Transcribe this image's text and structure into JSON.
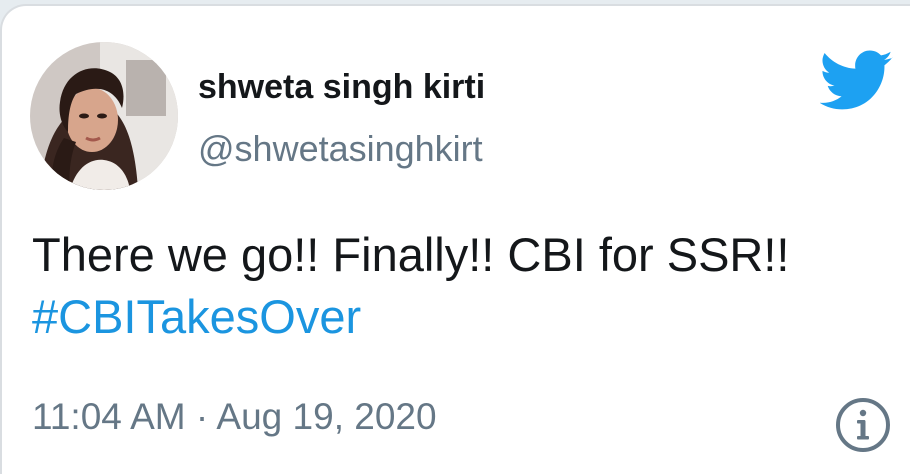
{
  "tweet": {
    "author": {
      "display_name": "shweta singh kirti",
      "handle": "@shwetasinghkirt",
      "avatar_icon": "profile-photo"
    },
    "text_plain": "There we go!! Finally!! CBI for SSR!! ",
    "hashtag": "#CBITakesOver",
    "timestamp": "11:04 AM · Aug 19, 2020",
    "brand_icon": "twitter-bird-icon",
    "info_icon": "info-icon"
  },
  "colors": {
    "brand_blue": "#1da1f2",
    "hashtag_blue": "#1b95e0",
    "text_primary": "#14171a",
    "text_secondary": "#657786"
  }
}
